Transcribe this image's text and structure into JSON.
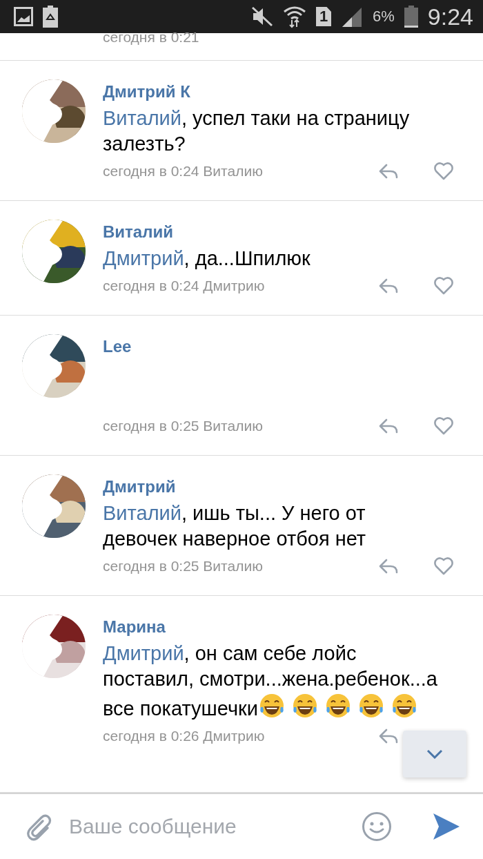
{
  "status_bar": {
    "sim_slot": "1",
    "battery": "6%",
    "time": "9:24"
  },
  "previous_comment": {
    "meta": "сегодня в 0:21"
  },
  "comments": [
    {
      "author": "Дмитрий К",
      "mention": "Виталий",
      "text": ", успел таки на страницу залезть?",
      "meta": "сегодня в 0:24 Виталию",
      "like_icon": true
    },
    {
      "author": "Виталий",
      "mention": "Дмитрий",
      "text": ", да...Шпилюк",
      "meta": "сегодня в 0:24 Дмитрию",
      "like_icon": true
    },
    {
      "author": "Lee",
      "meta": "сегодня в 0:25 Виталию",
      "like_icon": true
    },
    {
      "author": "Дмитрий",
      "mention": "Виталий",
      "text": ", ишь ты... У него от девочек наверное отбоя нет",
      "meta": "сегодня в 0:25 Виталию",
      "like_icon": true
    },
    {
      "author": "Марина",
      "mention": "Дмитрий",
      "text": ", он сам себе лойс поставил, смотри...жена.ребенок...а все покатушечки",
      "emojis": [
        {
          "kind": "tears-of-joy"
        },
        {
          "kind": "tears-of-joy"
        },
        {
          "kind": "tears-of-joy"
        },
        {
          "kind": "tears-of-joy"
        },
        {
          "kind": "tears-of-joy"
        }
      ],
      "meta": "сегодня в 0:26 Дмитрию",
      "like_icon": false
    }
  ],
  "scroll_down_button": true,
  "composer": {
    "placeholder": "Ваше сообщение"
  }
}
